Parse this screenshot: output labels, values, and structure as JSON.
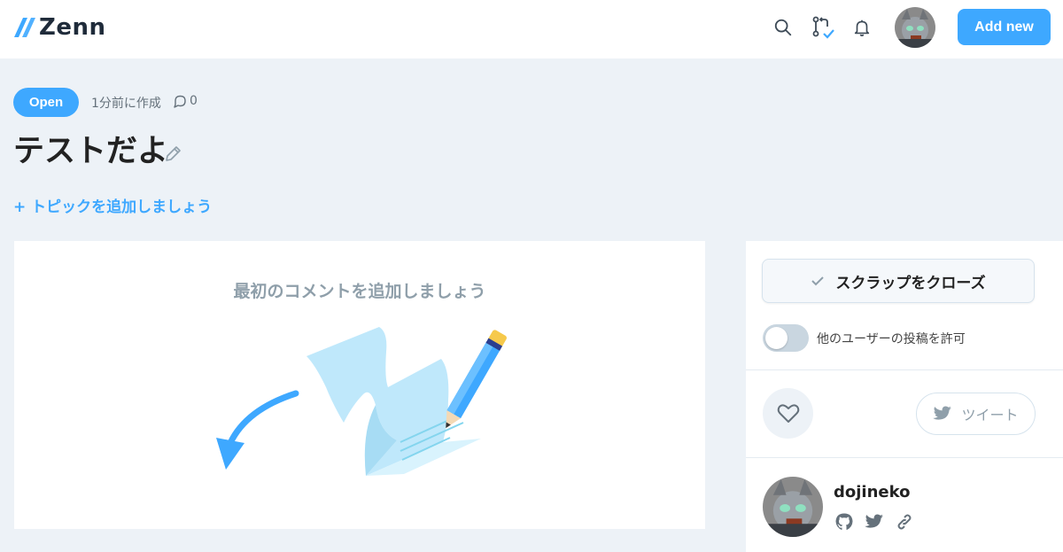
{
  "header": {
    "logo_text": "Zenn",
    "icons": [
      "search-icon",
      "pull-request-icon",
      "bell-icon"
    ],
    "add_new_label": "Add new",
    "brand_color": "#3ea8ff"
  },
  "scrap": {
    "status": "Open",
    "created_ago": "1分前に作成",
    "comment_count": "0",
    "title": "テストだよ",
    "add_topic": "+ トピックを追加しましょう"
  },
  "main": {
    "empty_message": "最初のコメントを追加しましょう"
  },
  "sidebar": {
    "close_label": "スクラップをクローズ",
    "toggle_label": "他のユーザーの投稿を許可",
    "toggle_on": false,
    "tweet_label": "ツイート",
    "author": {
      "name": "dojineko",
      "links": [
        "github-icon",
        "twitter-icon",
        "link-icon"
      ]
    }
  }
}
